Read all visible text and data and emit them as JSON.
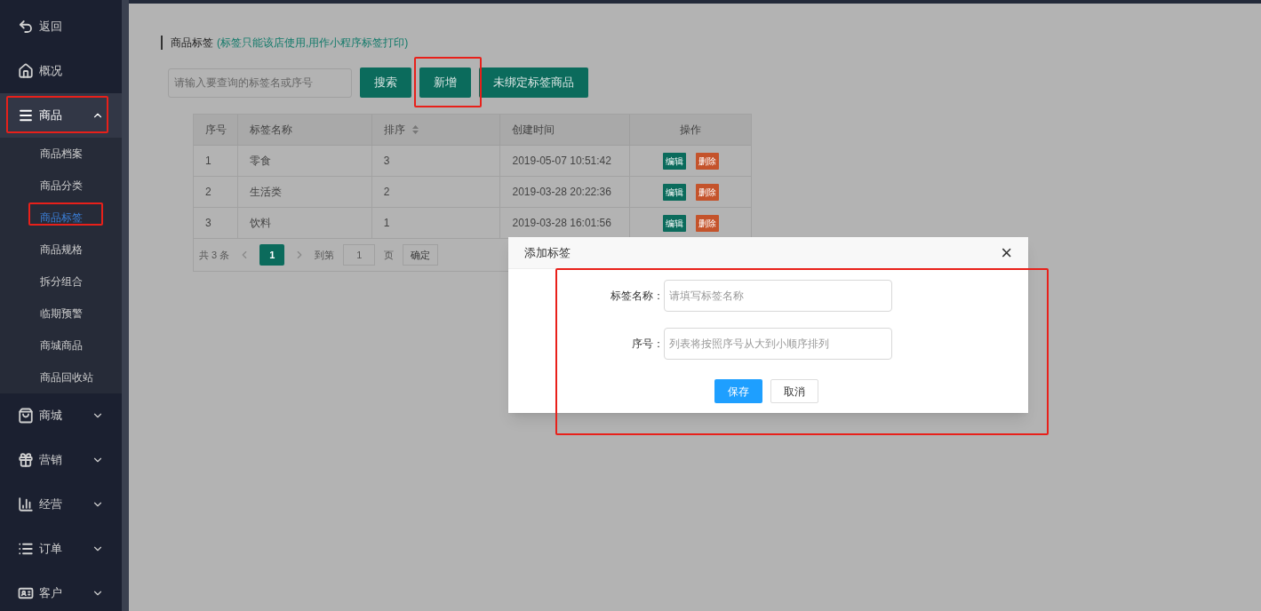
{
  "sidebar": {
    "items": [
      {
        "label": "返回",
        "selected": false
      },
      {
        "label": "概况",
        "selected": false
      },
      {
        "label": "商品",
        "expanded": true,
        "selected": true,
        "children": [
          {
            "label": "商品档案",
            "selected": false
          },
          {
            "label": "商品分类",
            "selected": false
          },
          {
            "label": "商品标签",
            "selected": true
          },
          {
            "label": "商品规格",
            "selected": false
          },
          {
            "label": "拆分组合",
            "selected": false
          },
          {
            "label": "临期预警",
            "selected": false
          },
          {
            "label": "商城商品",
            "selected": false
          },
          {
            "label": "商品回收站",
            "selected": false
          }
        ]
      },
      {
        "label": "商城",
        "expanded": false,
        "selected": false
      },
      {
        "label": "营销",
        "expanded": false,
        "selected": false
      },
      {
        "label": "经营",
        "expanded": false,
        "selected": false
      },
      {
        "label": "订单",
        "expanded": false,
        "selected": false
      },
      {
        "label": "客户",
        "expanded": false,
        "selected": false
      }
    ]
  },
  "page": {
    "title": "商品标签",
    "note": "(标签只能该店使用,用作小程序标签打印)"
  },
  "toolbar": {
    "search": {
      "placeholder": "请输入要查询的标签名或序号"
    },
    "buttons": [
      "搜索",
      "新增",
      "未绑定标签商品"
    ]
  },
  "table": {
    "columns": [
      {
        "label": "序号",
        "sortable": false
      },
      {
        "label": "标签名称",
        "sortable": false
      },
      {
        "label": "排序",
        "sortable": true
      },
      {
        "label": "创建时间",
        "sortable": false
      },
      {
        "label": "操作",
        "sortable": false
      }
    ],
    "rows": [
      {
        "cells": [
          "1",
          "零食",
          "3",
          "2019-05-07 10:51:42"
        ],
        "actions": [
          "编辑",
          "删除"
        ]
      },
      {
        "cells": [
          "2",
          "生活类",
          "2",
          "2019-03-28 20:22:36"
        ],
        "actions": [
          "编辑",
          "删除"
        ]
      },
      {
        "cells": [
          "3",
          "饮料",
          "1",
          "2019-03-28 16:01:56"
        ],
        "actions": [
          "编辑",
          "删除"
        ]
      }
    ]
  },
  "pagination": {
    "total": "共 3 条",
    "pages": [
      {
        "label": "1",
        "selected": true
      }
    ],
    "goto_label": "到第",
    "goto_value": "1",
    "page_unit": "页",
    "confirm": "确定"
  },
  "dialog": {
    "title": "添加标签",
    "close": "×",
    "fields": [
      {
        "label": "标签名称：",
        "placeholder": "请填写标签名称"
      },
      {
        "label": "序号：",
        "placeholder": "列表将按照序号从大到小顺序排列"
      }
    ],
    "buttons": [
      {
        "label": "保存",
        "kind": "primary"
      },
      {
        "label": "取消",
        "kind": "default"
      }
    ]
  }
}
